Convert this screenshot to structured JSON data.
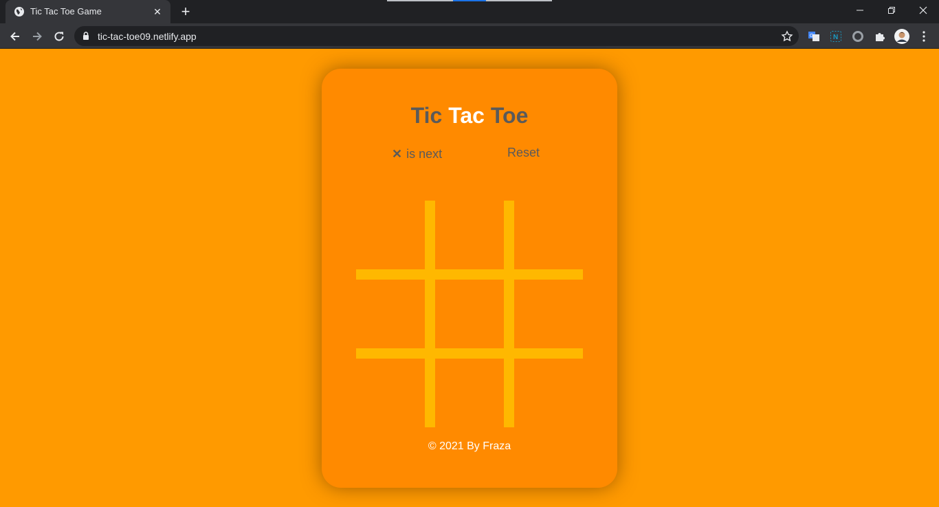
{
  "browser": {
    "tab_title": "Tic Tac Toe Game",
    "url": "tic-tac-toe09.netlify.app",
    "icons": [
      "globe-icon",
      "close-icon",
      "plus-icon",
      "back-icon",
      "forward-icon",
      "reload-icon",
      "lock-icon",
      "star-icon",
      "translate-icon",
      "extension-n-icon",
      "circle-icon",
      "puzzle-icon",
      "profile-avatar",
      "menu-icon"
    ]
  },
  "game": {
    "title_parts": [
      "Tic",
      "Tac",
      "Toe"
    ],
    "next_player": "✕",
    "status_suffix": "is next",
    "reset_label": "Reset",
    "footer": "© 2021 By Fraza",
    "board": [
      "",
      "",
      "",
      "",
      "",
      "",
      "",
      "",
      ""
    ]
  },
  "colors": {
    "page_bg": "#ff9a00",
    "card_bg": "#ff8a00",
    "grid": "#ffb800",
    "text_dark": "#5a5a5a"
  }
}
